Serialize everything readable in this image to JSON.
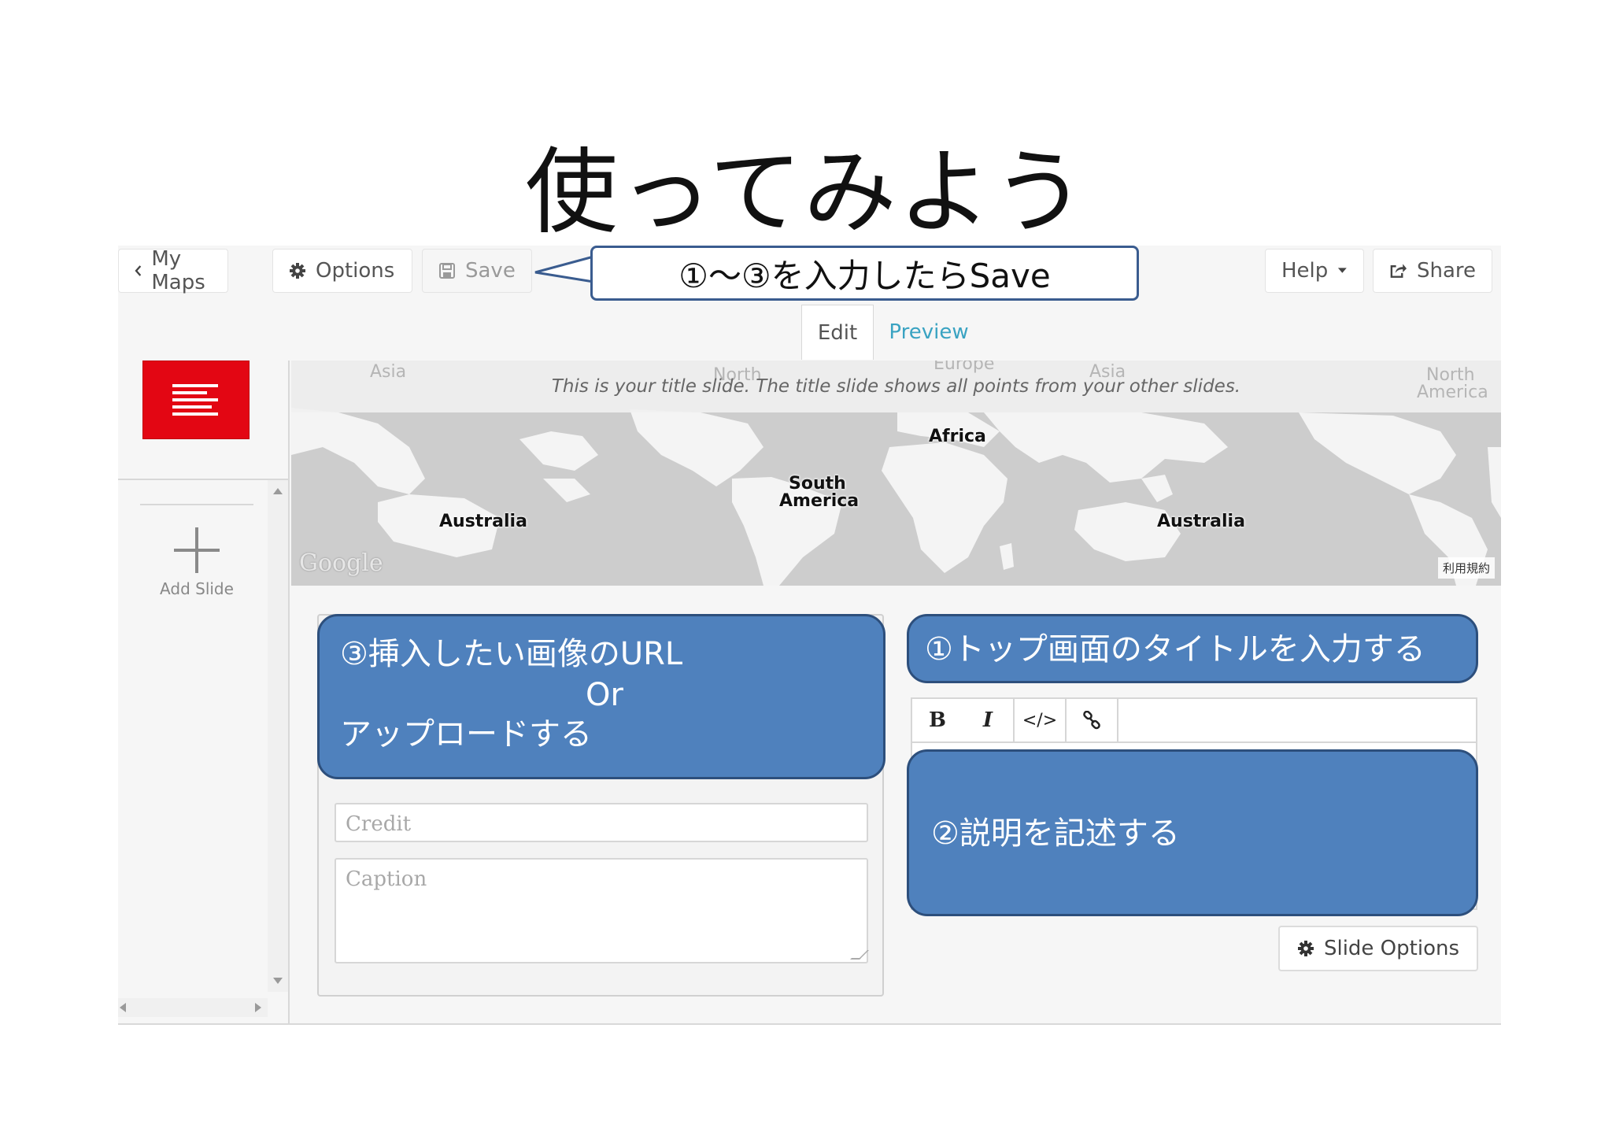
{
  "slide": {
    "title": "使ってみよう"
  },
  "toolbar": {
    "my_maps": "My Maps",
    "options": "Options",
    "save": "Save",
    "help": "Help",
    "share": "Share"
  },
  "callouts": {
    "save_hint": "①～③を入力したらSave",
    "image_hint_line1": "③挿入したい画像のURL",
    "image_hint_line2": "Or",
    "image_hint_line3": "アップロードする",
    "title_hint": "①トップ画面のタイトルを入力する",
    "desc_hint": "②説明を記述する"
  },
  "tabs": {
    "edit": "Edit",
    "preview": "Preview"
  },
  "sidebar": {
    "add_slide": "Add Slide"
  },
  "map": {
    "note": "This is your title slide. The title slide shows all points from your other slides.",
    "labels": {
      "africa": "Africa",
      "south_america_1": "South",
      "south_america_2": "America",
      "australia_left": "Australia",
      "australia_right": "Australia"
    },
    "ghost_labels": {
      "asia_left": "Asia",
      "north_left": "North",
      "europe": "Europe",
      "asia_right": "Asia",
      "north_right_1": "North",
      "north_right_2": "America"
    },
    "google": "Google",
    "terms": "利用規約"
  },
  "form": {
    "credit_placeholder": "Credit",
    "caption_placeholder": "Caption"
  },
  "editor": {
    "bold": "B",
    "italic": "I",
    "code": "</>"
  },
  "slide_options": "Slide Options",
  "colors": {
    "callout_blue": "#4f81bd",
    "thumbnail_red": "#e30613",
    "preview_link": "#3aa3c2"
  }
}
